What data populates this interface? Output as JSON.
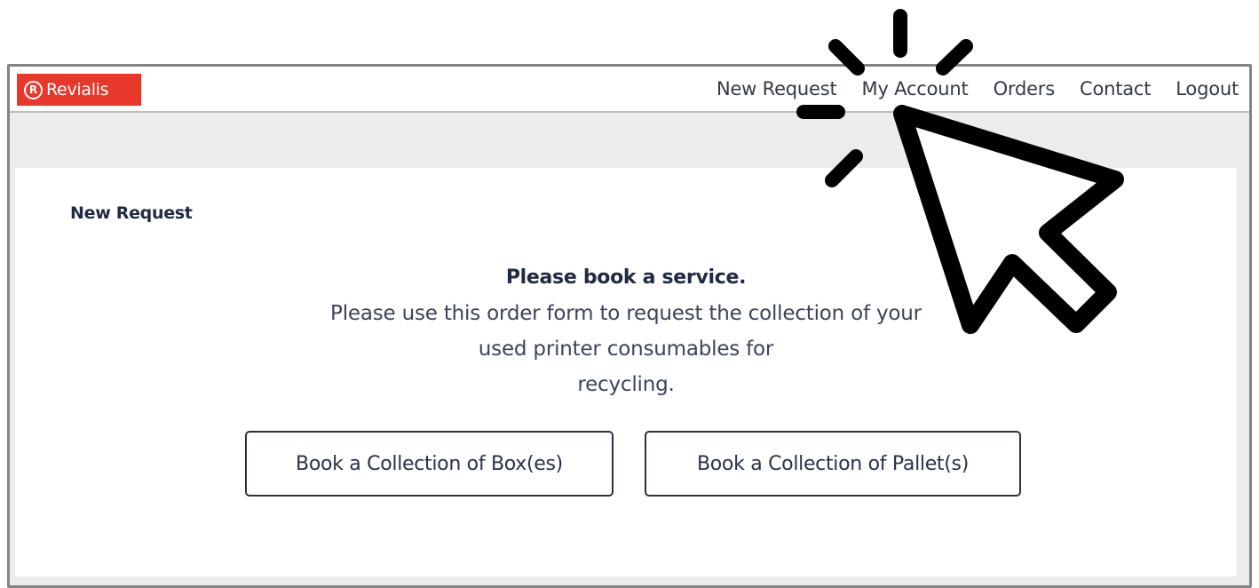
{
  "brand": {
    "name": "Revialis",
    "mark": "R",
    "color": "#e8382b"
  },
  "nav": {
    "items": [
      "New Request",
      "My Account",
      "Orders",
      "Contact",
      "Logout"
    ]
  },
  "page": {
    "title": "New Request",
    "heading": "Please book a service.",
    "description_lines": [
      "Please use this order form to request the collection of your",
      "used printer consumables for",
      "recycling."
    ]
  },
  "actions": {
    "boxes_label": "Book a Collection of Box(es)",
    "pallets_label": "Book a Collection of Pallet(s)"
  },
  "overlay": {
    "icon": "click-cursor-icon"
  }
}
